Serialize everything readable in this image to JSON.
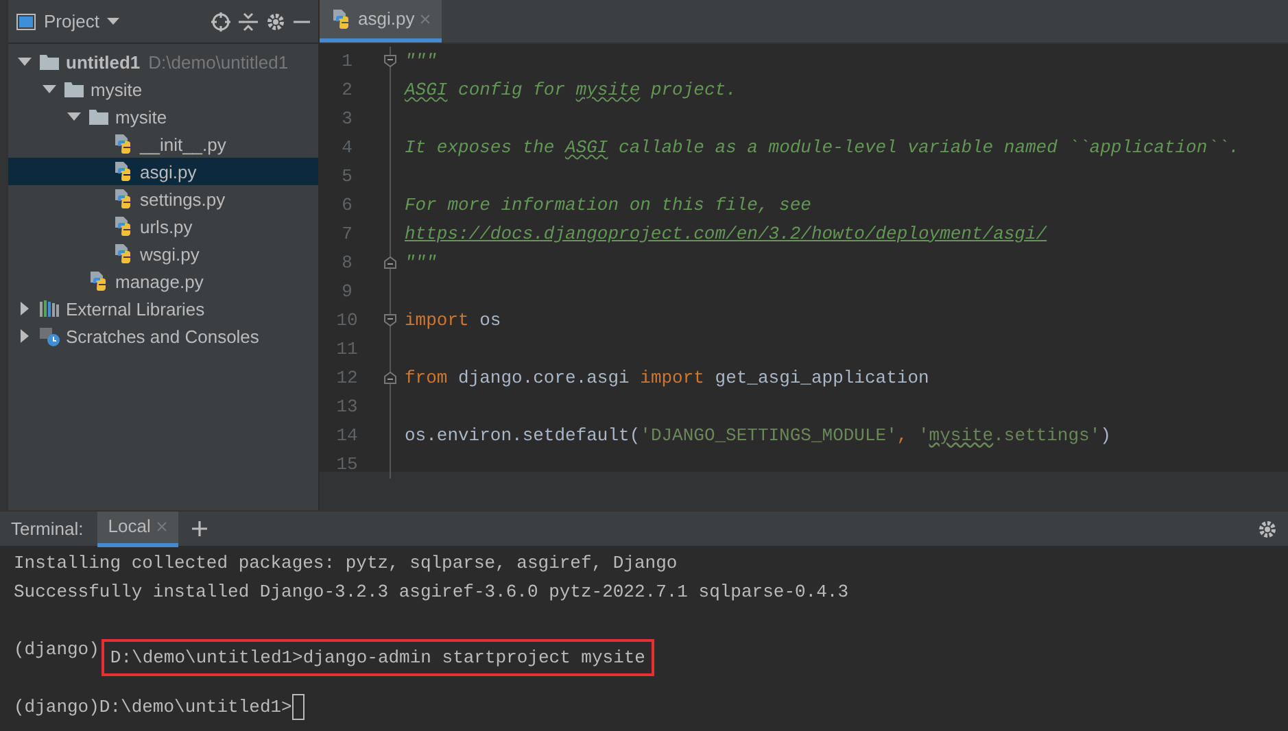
{
  "project_panel": {
    "title": "Project",
    "tree": [
      {
        "label": "untitled1",
        "hint": "D:\\demo\\untitled1",
        "kind": "folder",
        "expanded": true,
        "selected": false,
        "children": [
          {
            "label": "mysite",
            "kind": "folder",
            "expanded": true,
            "selected": false,
            "children": [
              {
                "label": "mysite",
                "kind": "folder",
                "expanded": true,
                "selected": false,
                "children": [
                  {
                    "label": "__init__.py",
                    "kind": "python",
                    "selected": false
                  },
                  {
                    "label": "asgi.py",
                    "kind": "python",
                    "selected": true
                  },
                  {
                    "label": "settings.py",
                    "kind": "python",
                    "selected": false
                  },
                  {
                    "label": "urls.py",
                    "kind": "python",
                    "selected": false
                  },
                  {
                    "label": "wsgi.py",
                    "kind": "python",
                    "selected": false
                  }
                ]
              },
              {
                "label": "manage.py",
                "kind": "python",
                "selected": false
              }
            ]
          }
        ]
      },
      {
        "label": "External Libraries",
        "kind": "libraries",
        "expanded": false,
        "selected": false
      },
      {
        "label": "Scratches and Consoles",
        "kind": "scratches",
        "expanded": false,
        "selected": false
      }
    ]
  },
  "editor": {
    "tabs": [
      {
        "label": "asgi.py",
        "selected": true
      }
    ],
    "lines": [
      {
        "number": "1",
        "kind": "fold-start",
        "segments": [
          {
            "text": "\"\"\"",
            "kind": "doc"
          }
        ]
      },
      {
        "number": "2",
        "segments": [
          {
            "text": "ASGI",
            "kind": "doc-typo"
          },
          {
            "text": " config for ",
            "kind": "doc"
          },
          {
            "text": "mysite",
            "kind": "doc-typo"
          },
          {
            "text": " project.",
            "kind": "doc"
          }
        ]
      },
      {
        "number": "3"
      },
      {
        "number": "4",
        "segments": [
          {
            "text": "It exposes the ",
            "kind": "doc"
          },
          {
            "text": "ASGI",
            "kind": "doc-typo"
          },
          {
            "text": " callable as a module-level variable named ``application``.",
            "kind": "doc"
          }
        ]
      },
      {
        "number": "5"
      },
      {
        "number": "6",
        "segments": [
          {
            "text": "For more information on this file, see",
            "kind": "doc"
          }
        ]
      },
      {
        "number": "7",
        "segments": [
          {
            "text": "https://docs.djangoproject.com/en/3.2/howto/deployment/asgi/",
            "kind": "link"
          }
        ]
      },
      {
        "number": "8",
        "kind": "fold-end",
        "segments": [
          {
            "text": "\"\"\"",
            "kind": "doc"
          }
        ]
      },
      {
        "number": "9"
      },
      {
        "number": "10",
        "kind": "fold-start",
        "segments": [
          {
            "text": "import",
            "kind": "keyword"
          },
          {
            "text": " os",
            "kind": "plain"
          }
        ]
      },
      {
        "number": "11"
      },
      {
        "number": "12",
        "kind": "fold-end",
        "segments": [
          {
            "text": "from",
            "kind": "keyword"
          },
          {
            "text": " django.core.asgi ",
            "kind": "plain"
          },
          {
            "text": "import",
            "kind": "keyword"
          },
          {
            "text": " get_asgi_application",
            "kind": "plain"
          }
        ]
      },
      {
        "number": "13"
      },
      {
        "number": "14",
        "segments": [
          {
            "text": "os.environ.setdefault(",
            "kind": "plain"
          },
          {
            "text": "'DJANGO_SETTINGS_MODULE'",
            "kind": "string"
          },
          {
            "text": ", ",
            "kind": "keyword"
          },
          {
            "text": "'",
            "kind": "string"
          },
          {
            "text": "mysite",
            "kind": "string-typo"
          },
          {
            "text": ".settings'",
            "kind": "string"
          },
          {
            "text": ")",
            "kind": "plain"
          }
        ]
      },
      {
        "number": "15"
      }
    ]
  },
  "terminal": {
    "title": "Terminal:",
    "tabs": [
      {
        "label": "Local",
        "selected": true
      }
    ],
    "lines": [
      {
        "kind": "output",
        "text": "Installing collected packages: pytz, sqlparse, asgiref, Django"
      },
      {
        "kind": "output",
        "text": "Successfully installed Django-3.2.3 asgiref-3.6.0 pytz-2022.7.1 sqlparse-0.4.3"
      },
      {
        "kind": "blank"
      },
      {
        "kind": "command",
        "prompt": "(django)",
        "text": "D:\\demo\\untitled1>django-admin startproject mysite",
        "highlighted": true
      },
      {
        "kind": "blank"
      },
      {
        "kind": "command",
        "prompt": "(django)",
        "text": "D:\\demo\\untitled1>",
        "highlighted": false,
        "cursor": true
      }
    ]
  }
}
